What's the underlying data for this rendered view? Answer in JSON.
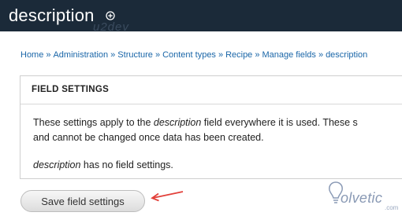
{
  "header": {
    "title": "description",
    "watermark": "u2dev"
  },
  "breadcrumb": [
    "Home",
    "Administration",
    "Structure",
    "Content types",
    "Recipe",
    "Manage fields",
    "description"
  ],
  "breadcrumb_separator": "»",
  "field_settings": {
    "legend": "FIELD SETTINGS",
    "line1_prefix": "These settings apply to the ",
    "line1_em": "description",
    "line1_suffix": " field everywhere it is used. These s",
    "line2": "and cannot be changed once data has been created.",
    "line3_em": "description",
    "line3_suffix": " has no field settings."
  },
  "save_button": {
    "label": "Save field settings"
  },
  "logo": {
    "name": "olvetic",
    "suffix": ".com"
  },
  "colors": {
    "header_bg": "#1b2a39",
    "link": "#1a66a8",
    "arrow": "#e2403a"
  }
}
